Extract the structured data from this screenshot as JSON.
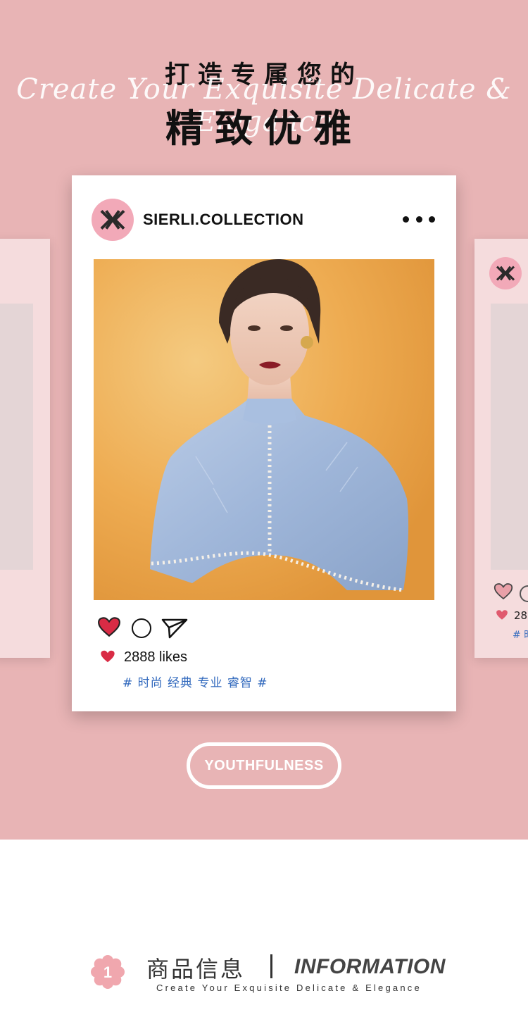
{
  "hero": {
    "title_line1": "打造专属您的",
    "script_text": "Create Your Exquisite Delicate & Elegance",
    "title_line2": "精致优雅",
    "background_color": "#e8b4b5"
  },
  "post": {
    "handle": "SIERLI.COLLECTION",
    "logo_icon": "sierli-monogram-icon",
    "more_icon": "more-dots-icon",
    "actions": {
      "like_icon": "heart-icon",
      "comment_icon": "comment-circle-icon",
      "share_icon": "paper-plane-icon"
    },
    "likes_text": "2888 likes",
    "tags_text": "# 时尚 经典 专业 睿智 #",
    "like_color": "#d92b45",
    "tag_color": "#3068bd"
  },
  "side_card_right": {
    "likes_text": "28",
    "tags_text": "# 时"
  },
  "badge": {
    "label": "YOUTHFULNESS"
  },
  "section": {
    "number": "1",
    "title_cn": "商品信息",
    "title_en": "INFORMATION",
    "subtitle": "Create Your Exquisite Delicate & Elegance"
  }
}
